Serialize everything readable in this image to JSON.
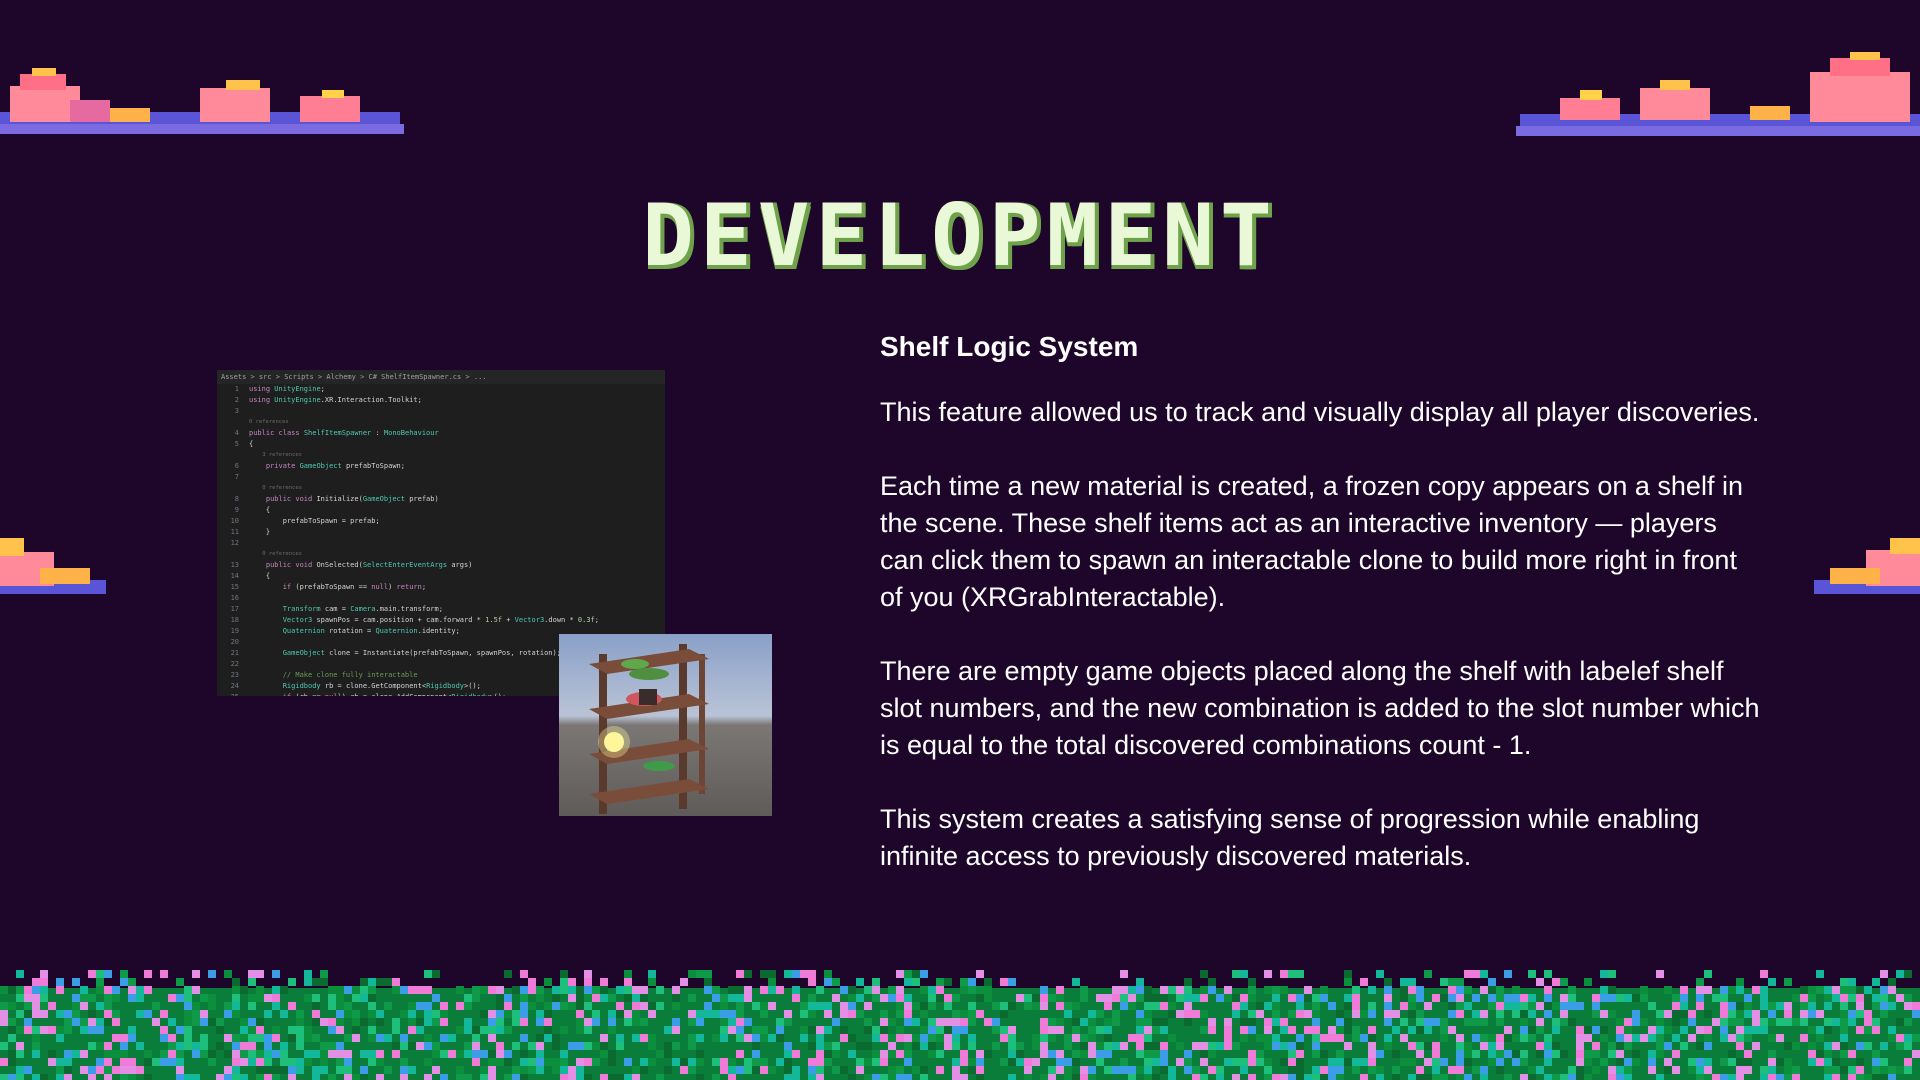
{
  "slide": {
    "title": "DEVELOPMENT",
    "heading": "Shelf Logic System",
    "paragraphs": [
      "This feature allowed us to track and visually display all player discoveries.",
      "Each time a new material is created, a frozen copy appears on a shelf in the scene. These shelf items act as an interactive inventory — players can click them to spawn an interactable clone to build more right in front of you (XRGrabInteractable).",
      "There are empty game objects placed along the shelf with labelef shelf slot numbers, and the new combination is added to the slot number which is equal to the total discovered combinations count - 1.",
      "This system creates a satisfying sense of progression while enabling infinite access to previously discovered materials."
    ]
  },
  "code_screenshot": {
    "breadcrumb": "Assets > src > Scripts > Alchemy > C# ShelfItemSpawner.cs > ...",
    "lines": [
      {
        "n": "1",
        "text": "using UnityEngine;"
      },
      {
        "n": "2",
        "text": "using UnityEngine.XR.Interaction.Toolkit;"
      },
      {
        "n": "3",
        "text": ""
      },
      {
        "n": "",
        "text": "0 references",
        "ref": true
      },
      {
        "n": "4",
        "text": "public class ShelfItemSpawner : MonoBehaviour"
      },
      {
        "n": "5",
        "text": "{"
      },
      {
        "n": "",
        "text": "    3 references",
        "ref": true
      },
      {
        "n": "6",
        "text": "    private GameObject prefabToSpawn;"
      },
      {
        "n": "7",
        "text": ""
      },
      {
        "n": "",
        "text": "    0 references",
        "ref": true
      },
      {
        "n": "8",
        "text": "    public void Initialize(GameObject prefab)"
      },
      {
        "n": "9",
        "text": "    {"
      },
      {
        "n": "10",
        "text": "        prefabToSpawn = prefab;"
      },
      {
        "n": "11",
        "text": "    }"
      },
      {
        "n": "12",
        "text": ""
      },
      {
        "n": "",
        "text": "    0 references",
        "ref": true
      },
      {
        "n": "13",
        "text": "    public void OnSelected(SelectEnterEventArgs args)"
      },
      {
        "n": "14",
        "text": "    {"
      },
      {
        "n": "15",
        "text": "        if (prefabToSpawn == null) return;"
      },
      {
        "n": "16",
        "text": ""
      },
      {
        "n": "17",
        "text": "        Transform cam = Camera.main.transform;"
      },
      {
        "n": "18",
        "text": "        Vector3 spawnPos = cam.position + cam.forward * 1.5f + Vector3.down * 0.3f;"
      },
      {
        "n": "19",
        "text": "        Quaternion rotation = Quaternion.identity;"
      },
      {
        "n": "20",
        "text": ""
      },
      {
        "n": "21",
        "text": "        GameObject clone = Instantiate(prefabToSpawn, spawnPos, rotation);"
      },
      {
        "n": "22",
        "text": ""
      },
      {
        "n": "23",
        "text": "        // Make clone fully interactable"
      },
      {
        "n": "24",
        "text": "        Rigidbody rb = clone.GetComponent<Rigidbody>();"
      },
      {
        "n": "25",
        "text": "        if (rb == null) rb = clone.AddComponent<Rigidbody>();"
      }
    ]
  },
  "colors": {
    "background": "#1d0629",
    "title": "#e9f8d6",
    "grass": "#0b7d3a"
  }
}
